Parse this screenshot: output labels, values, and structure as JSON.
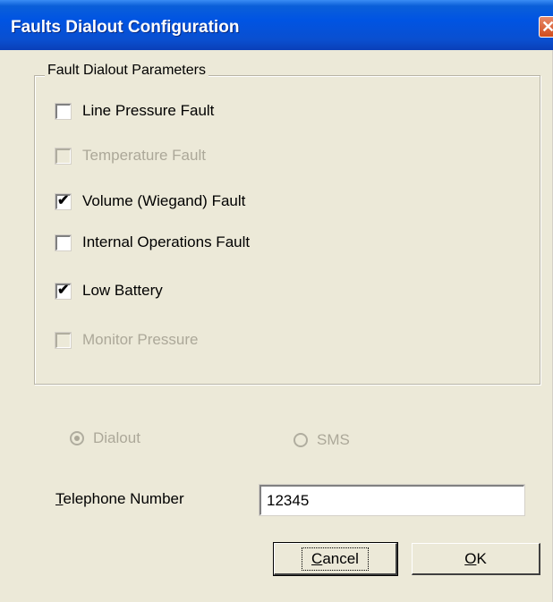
{
  "window": {
    "title": "Faults Dialout Configuration",
    "close_glyph": "✕"
  },
  "group": {
    "legend": "Fault Dialout Parameters",
    "items": [
      {
        "label": "Line Pressure Fault",
        "checked": false,
        "enabled": true
      },
      {
        "label": "Temperature Fault",
        "checked": false,
        "enabled": false
      },
      {
        "label": "Volume (Wiegand) Fault",
        "checked": true,
        "enabled": true
      },
      {
        "label": "Internal Operations Fault",
        "checked": false,
        "enabled": true
      },
      {
        "label": "Low Battery",
        "checked": true,
        "enabled": true
      },
      {
        "label": "Monitor Pressure",
        "checked": false,
        "enabled": false
      }
    ]
  },
  "mode": {
    "options": [
      {
        "label": "Dialout",
        "selected": true,
        "enabled": false
      },
      {
        "label": "SMS",
        "selected": false,
        "enabled": false
      }
    ]
  },
  "telephone": {
    "label_mnemonic": "T",
    "label_rest": "elephone Number",
    "value": "12345"
  },
  "buttons": {
    "cancel_mnemonic": "C",
    "cancel_rest": "ancel",
    "ok_mnemonic": "O",
    "ok_rest": "K"
  },
  "colors": {
    "titlebar": "#0054e3",
    "dialog_bg": "#ece9d8",
    "disabled_text": "#aca899"
  }
}
